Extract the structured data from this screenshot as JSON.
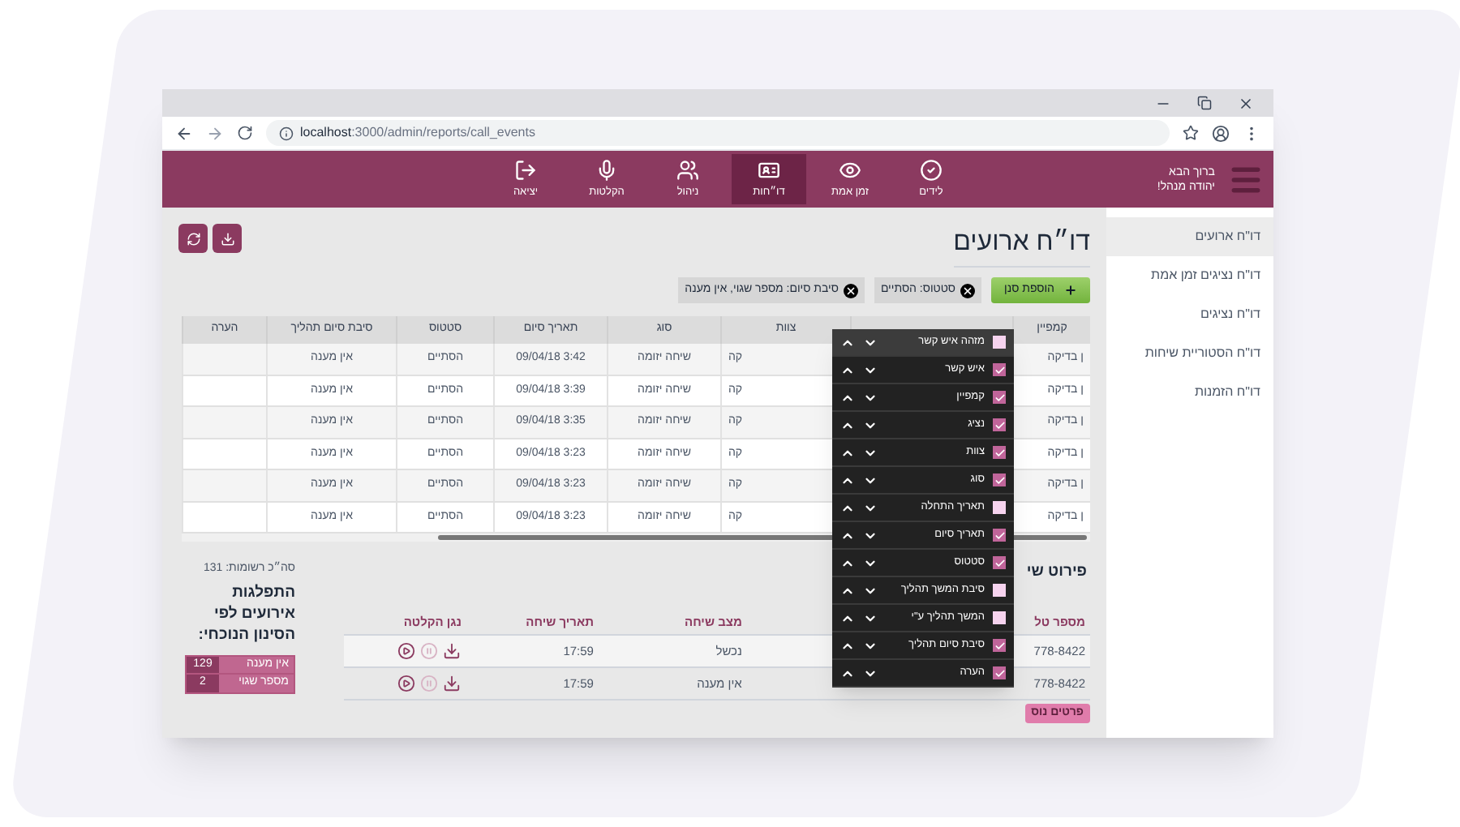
{
  "browser": {
    "url_host": "localhost",
    "url_path": ":3000/admin/reports/call_events"
  },
  "header": {
    "greeting": "ברוך הבא",
    "user": "יהודה מנהל!",
    "nav": [
      {
        "label": "לידים",
        "kind": "leads",
        "selected": false
      },
      {
        "label": "זמן אמת",
        "kind": "realtime",
        "selected": false
      },
      {
        "label": "דו״חות",
        "kind": "reports",
        "selected": true
      },
      {
        "label": "ניהול",
        "kind": "management",
        "selected": false
      },
      {
        "label": "הקלטות",
        "kind": "recordings",
        "selected": false
      },
      {
        "label": "יציאה",
        "kind": "logout",
        "selected": false
      }
    ]
  },
  "sidebar": {
    "items": [
      {
        "label": "דו\"ח ארועים",
        "selected": true
      },
      {
        "label": "דו\"ח נציגים זמן אמת",
        "selected": false
      },
      {
        "label": "דו\"ח נציגים",
        "selected": false
      },
      {
        "label": "דו\"ח הסטוריית שיחות",
        "selected": false
      },
      {
        "label": "דו\"ח הזמנות",
        "selected": false
      }
    ]
  },
  "page": {
    "title": "דו״ח ארועים"
  },
  "filters": {
    "add_label": "הוספת סנן",
    "chips": [
      {
        "label": "סטטוס: הסתיים"
      },
      {
        "label": "סיבת סיום: מספר שגוי, אין מענה"
      }
    ]
  },
  "table": {
    "columns": [
      {
        "label": "קמפיין"
      },
      {
        "label": "צוות"
      },
      {
        "label": "סוג"
      },
      {
        "label": "תאריך סיום"
      },
      {
        "label": "סטטוס"
      },
      {
        "label": "סיבת סיום תהליך"
      },
      {
        "label": "הערה"
      }
    ],
    "rows": [
      {
        "cells": [
          "ן בדיקה",
          "קה",
          "שיחה יזומה",
          "3:42 09/04/18",
          "הסתיים",
          "אין מענה"
        ]
      },
      {
        "cells": [
          "ן בדיקה",
          "קה",
          "שיחה יזומה",
          "3:39 09/04/18",
          "הסתיים",
          "אין מענה"
        ]
      },
      {
        "cells": [
          "ן בדיקה",
          "קה",
          "שיחה יזומה",
          "3:35 09/04/18",
          "הסתיים",
          "אין מענה"
        ]
      },
      {
        "cells": [
          "ן בדיקה",
          "קה",
          "שיחה יזומה",
          "3:23 09/04/18",
          "הסתיים",
          "אין מענה"
        ]
      },
      {
        "cells": [
          "ן בדיקה",
          "קה",
          "שיחה יזומה",
          "3:23 09/04/18",
          "הסתיים",
          "אין מענה"
        ]
      },
      {
        "cells": [
          "ן בדיקה",
          "קה",
          "שיחה יזומה",
          "3:23 09/04/18",
          "הסתיים",
          "אין מענה"
        ]
      }
    ]
  },
  "column_picker": {
    "items": [
      {
        "label": "מזהה איש קשר",
        "checked": false,
        "highlighted": true
      },
      {
        "label": "איש קשר",
        "checked": true,
        "highlighted": false
      },
      {
        "label": "קמפיין",
        "checked": true,
        "highlighted": false
      },
      {
        "label": "נציג",
        "checked": true,
        "highlighted": false
      },
      {
        "label": "צוות",
        "checked": true,
        "highlighted": false
      },
      {
        "label": "סוג",
        "checked": true,
        "highlighted": false
      },
      {
        "label": "תאריך התחלה",
        "checked": false,
        "highlighted": false
      },
      {
        "label": "תאריך סיום",
        "checked": true,
        "highlighted": false
      },
      {
        "label": "סטטוס",
        "checked": true,
        "highlighted": false
      },
      {
        "label": "סיבת המשך תהליך",
        "checked": false,
        "highlighted": false
      },
      {
        "label": "המשך תהליך ע\"י",
        "checked": false,
        "highlighted": false
      },
      {
        "label": "סיבת סיום תהליך",
        "checked": true,
        "highlighted": false
      },
      {
        "label": "הערה",
        "checked": true,
        "highlighted": false
      }
    ]
  },
  "details": {
    "title": "פירוט שי",
    "columns": [
      "מספר טל",
      "מצב שיחה",
      "תאריך שיחה",
      "נגן הקלטה"
    ],
    "rows": [
      {
        "cells": [
          "778-8422",
          "נכשל",
          "17:59"
        ]
      },
      {
        "cells": [
          "778-8422",
          "אין מענה",
          "17:59"
        ]
      }
    ],
    "more_button": "פרטים נוס"
  },
  "summary": {
    "total": "סה״כ רשומות: 131",
    "title": "התפלגות אירועים לפי הסינון הנוכחי:",
    "rows": [
      {
        "label": "אין מענה",
        "count": "129"
      },
      {
        "label": "מספר שגוי",
        "count": "2"
      }
    ]
  }
}
